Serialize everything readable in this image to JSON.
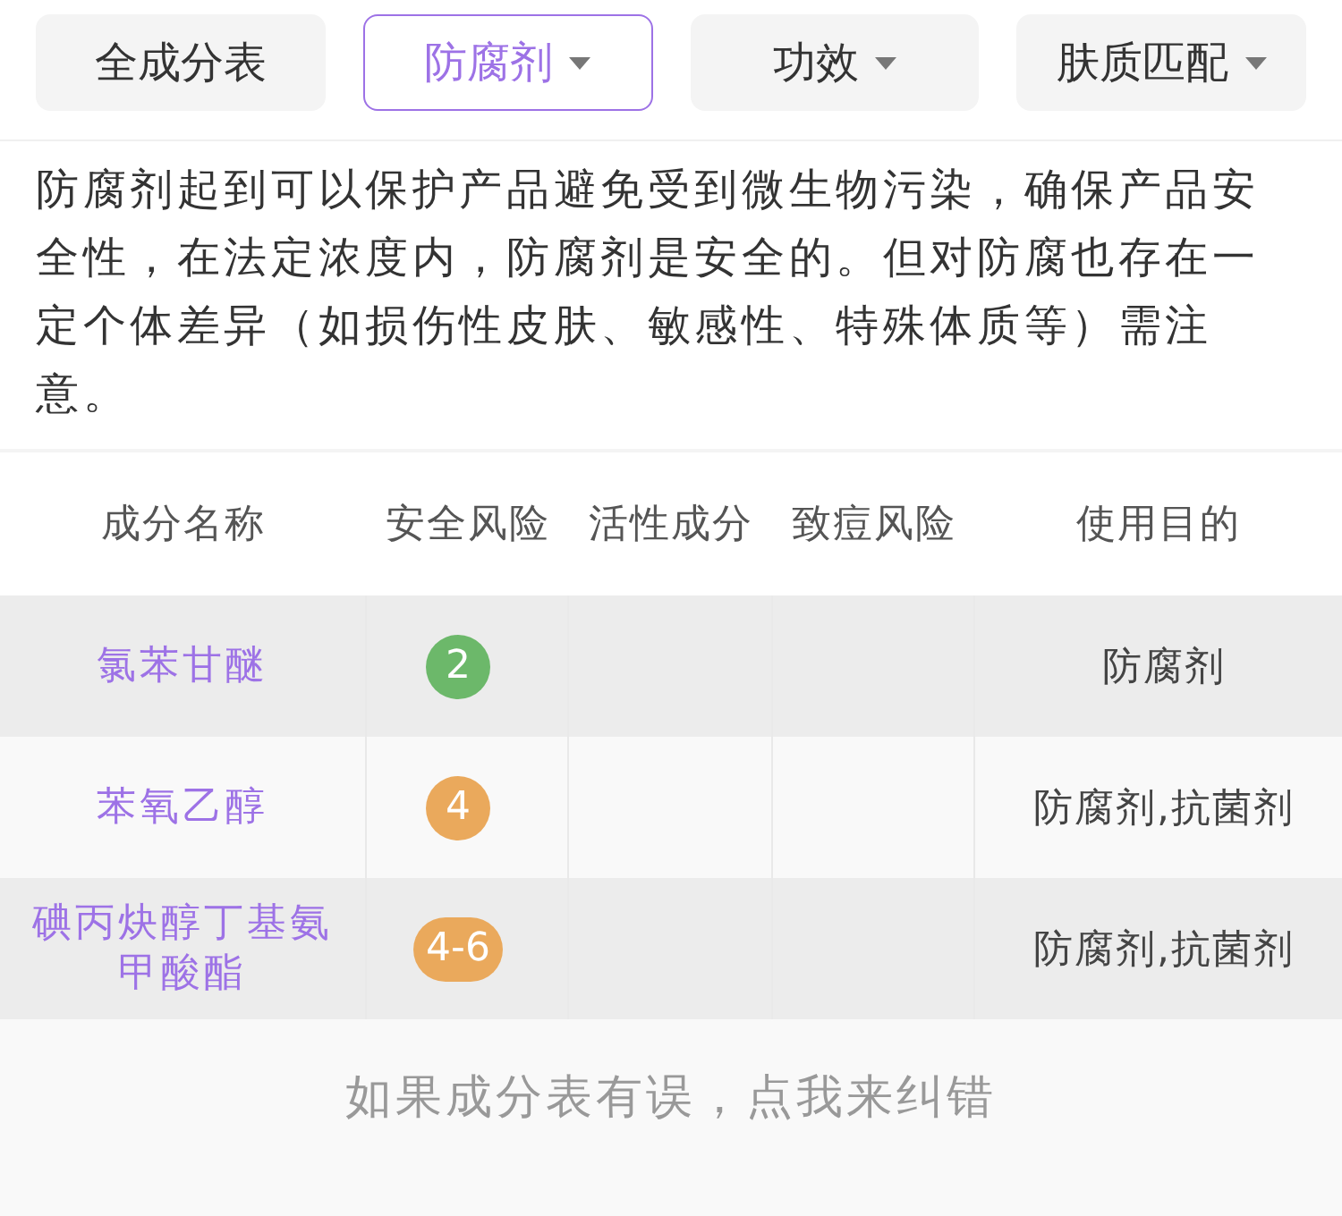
{
  "tabs": [
    {
      "label": "全成分表",
      "selected": false,
      "dropdown": false
    },
    {
      "label": "防腐剂",
      "selected": true,
      "dropdown": true
    },
    {
      "label": "功效",
      "selected": false,
      "dropdown": true
    },
    {
      "label": "肤质匹配",
      "selected": false,
      "dropdown": true
    }
  ],
  "description": "防腐剂起到可以保护产品避免受到微生物污染，确保产品安全性，在法定浓度内，防腐剂是安全的。但对防腐也存在一定个体差异（如损伤性皮肤、敏感性、特殊体质等）需注意。",
  "table": {
    "columns": [
      "成分名称",
      "安全风险",
      "活性成分",
      "致痘风险",
      "使用目的"
    ],
    "rows": [
      {
        "name": "氯苯甘醚",
        "safety_risk": {
          "text": "2",
          "color": "#6cb86a"
        },
        "purpose": "防腐剂"
      },
      {
        "name": "苯氧乙醇",
        "safety_risk": {
          "text": "4",
          "color": "#eaa95c"
        },
        "purpose": "防腐剂,抗菌剂"
      },
      {
        "name": "碘丙炔醇丁基氨甲酸酯",
        "safety_risk": {
          "text": "4-6",
          "color": "#eaa95c"
        },
        "purpose": "防腐剂,抗菌剂"
      }
    ]
  },
  "footer": {
    "link": "如果成分表有误，点我来纠错"
  }
}
